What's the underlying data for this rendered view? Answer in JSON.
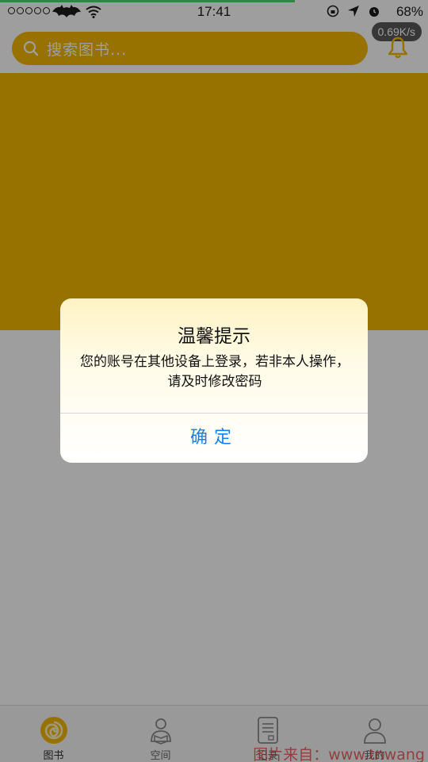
{
  "status_bar": {
    "time": "17:41",
    "battery": "68%",
    "net_speed": "0.69K/s"
  },
  "search": {
    "placeholder": "搜索图书..."
  },
  "colors": {
    "accent": "#f5b800",
    "link_blue": "#1a7fe6"
  },
  "tabs": [
    {
      "label": "图书",
      "icon": "book-swirl-icon",
      "active": true
    },
    {
      "label": "空间",
      "icon": "space-person-icon",
      "active": false
    },
    {
      "label": "记录",
      "icon": "record-document-icon",
      "active": false
    },
    {
      "label": "我的",
      "icon": "profile-person-icon",
      "active": false
    }
  ],
  "alert": {
    "title": "温馨提示",
    "message": "您的账号在其他设备上登录，若非本人操作，请及时修改密码",
    "confirm_label": "确定"
  },
  "watermark": "图片来自：www.tnwang"
}
